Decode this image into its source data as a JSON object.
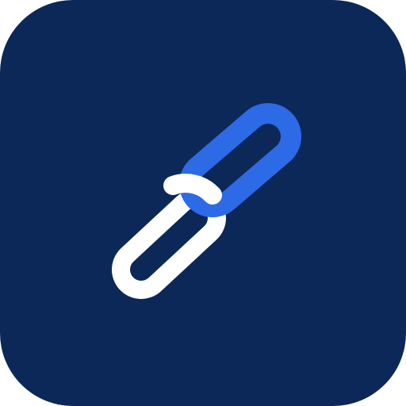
{
  "app_icon": {
    "icon": "link-icon",
    "colors": {
      "tile": "#0c2858",
      "back_link": "#ffffff",
      "front_link": "#2d6ae6"
    }
  }
}
